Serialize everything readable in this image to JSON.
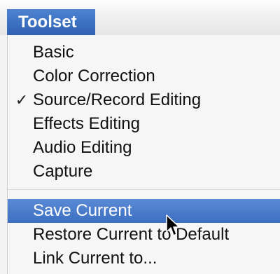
{
  "menubar": {
    "title": "Toolset"
  },
  "menu": {
    "items": [
      {
        "label": "Basic",
        "checked": false
      },
      {
        "label": "Color Correction",
        "checked": false
      },
      {
        "label": "Source/Record Editing",
        "checked": true,
        "check_glyph": "✓"
      },
      {
        "label": "Effects Editing",
        "checked": false
      },
      {
        "label": "Audio Editing",
        "checked": false
      },
      {
        "label": "Capture",
        "checked": false
      }
    ],
    "actions": [
      {
        "label": "Save Current",
        "highlighted": true
      },
      {
        "label": "Restore Current to Default",
        "highlighted": false
      },
      {
        "label": "Link Current to...",
        "highlighted": false
      }
    ]
  },
  "colors": {
    "highlight": "#3d6fc1",
    "title_bg": "#3b6fc0"
  },
  "icons": {
    "cursor": "mouse-pointer-icon",
    "check": "checkmark-icon"
  }
}
